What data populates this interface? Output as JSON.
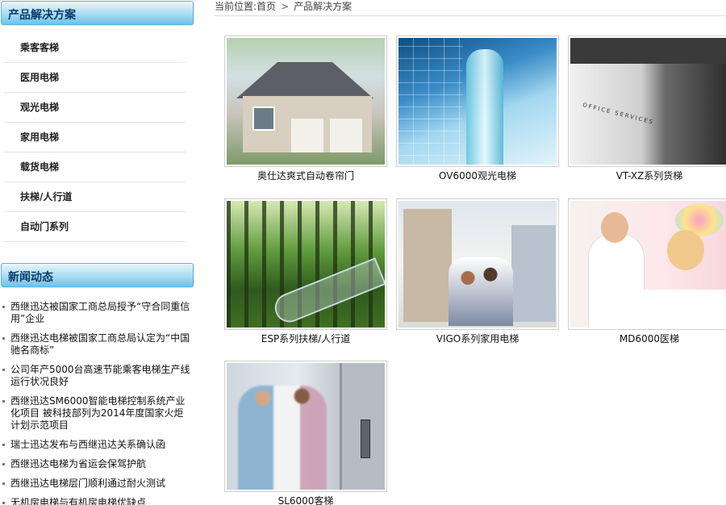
{
  "sidebar": {
    "products_title": "产品解决方案",
    "categories": [
      {
        "label": "乘客客梯"
      },
      {
        "label": "医用电梯"
      },
      {
        "label": "观光电梯"
      },
      {
        "label": "家用电梯"
      },
      {
        "label": "载货电梯"
      },
      {
        "label": "扶梯/人行道"
      },
      {
        "label": "自动门系列"
      }
    ],
    "news_title": "新闻动态",
    "news": [
      {
        "text": "西继迅达被国家工商总局授予“守合同重信用”企业"
      },
      {
        "text": "西继迅达电梯被国家工商总局认定为“中国驰名商标”"
      },
      {
        "text": "公司年产5000台高速节能乘客电梯生产线运行状况良好"
      },
      {
        "text": "西继迅达SM6000智能电梯控制系统产业化项目 被科技部列为2014年度国家火炬计划示范项目"
      },
      {
        "text": "瑞士迅达发布与西继迅达关系确认函"
      },
      {
        "text": "西继迅达电梯为省运会保驾护航"
      },
      {
        "text": "西继迅达电梯层门顺利通过耐火测试"
      },
      {
        "text": "无机房电梯与有机房电梯优缺点"
      }
    ]
  },
  "breadcrumb": {
    "prefix": "当前位置:",
    "home": "首页",
    "separator": ">",
    "current": "产品解决方案"
  },
  "products": [
    {
      "caption": "奥仕达爽式自动卷帘门"
    },
    {
      "caption": "OV6000观光电梯"
    },
    {
      "caption": "VT-XZ系列货梯"
    },
    {
      "caption": "ESP系列扶梯/人行道"
    },
    {
      "caption": "VIGO系列家用电梯"
    },
    {
      "caption": "MD6000医梯"
    },
    {
      "caption": "SL6000客梯"
    }
  ],
  "images": {
    "office_sign": "OFFICE SERVICES"
  }
}
